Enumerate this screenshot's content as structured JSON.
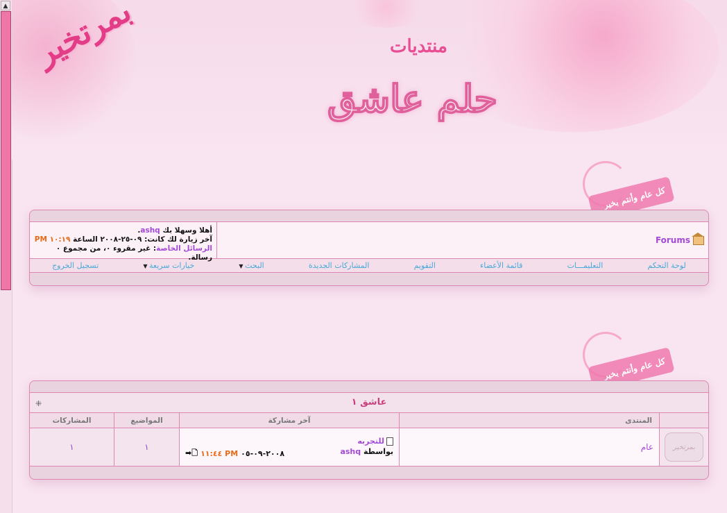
{
  "header": {
    "title_small": "منتديات",
    "title_big": "حلم عاشق",
    "art_text": "بمرتخير"
  },
  "badges": {
    "text": "كل عام وأنتم بخير"
  },
  "nav": {
    "breadcrumb": "Forums",
    "welcome": "أهلا وسهلا بك",
    "username": "ashq",
    "last_visit_label": "آخر زيارة لك كانت:",
    "last_visit_date": "٠٩-٢٥-٢٠٠٨",
    "last_visit_at": "الساعة",
    "last_visit_time": "١٠:١٩ PM",
    "pm_label": "الرسائل الخاصة",
    "pm_text": ": غير مقروء ٠، من مجموع ٠ رسالة.",
    "menu": [
      {
        "label": "لوحة التحكم",
        "dropdown": false
      },
      {
        "label": "التعليمـــات",
        "dropdown": false
      },
      {
        "label": "قائمة الأعضاء",
        "dropdown": false
      },
      {
        "label": "التقويم",
        "dropdown": false
      },
      {
        "label": "المشاركات الجديدة",
        "dropdown": false
      },
      {
        "label": "البحث",
        "dropdown": true
      },
      {
        "label": "خيارات سريعة",
        "dropdown": true
      },
      {
        "label": "تسجيل الخروج",
        "dropdown": false
      }
    ]
  },
  "forum_table": {
    "category": "عاشق ١",
    "collapse_icon": "collapse-icon",
    "columns": {
      "forum": "المنتدى",
      "last_post": "آخر مشاركة",
      "threads": "المواضيع",
      "posts": "المشاركات"
    },
    "rows": [
      {
        "forum_name": "عام",
        "icon_text": "بمرتخير",
        "last_post_title": "للتجربه",
        "by_label": "بواسطة",
        "last_post_user": "ashq",
        "last_post_date": "٢٠٠٨-٠٩-٠٥",
        "last_post_time": "١١:٤٤ PM",
        "threads": "١",
        "posts": "١"
      }
    ]
  },
  "colors": {
    "accent": "#e84e93",
    "link": "#a54ad4",
    "menu_link": "#4aa9d9",
    "border": "#dc87b1",
    "time": "#e66b1a"
  }
}
